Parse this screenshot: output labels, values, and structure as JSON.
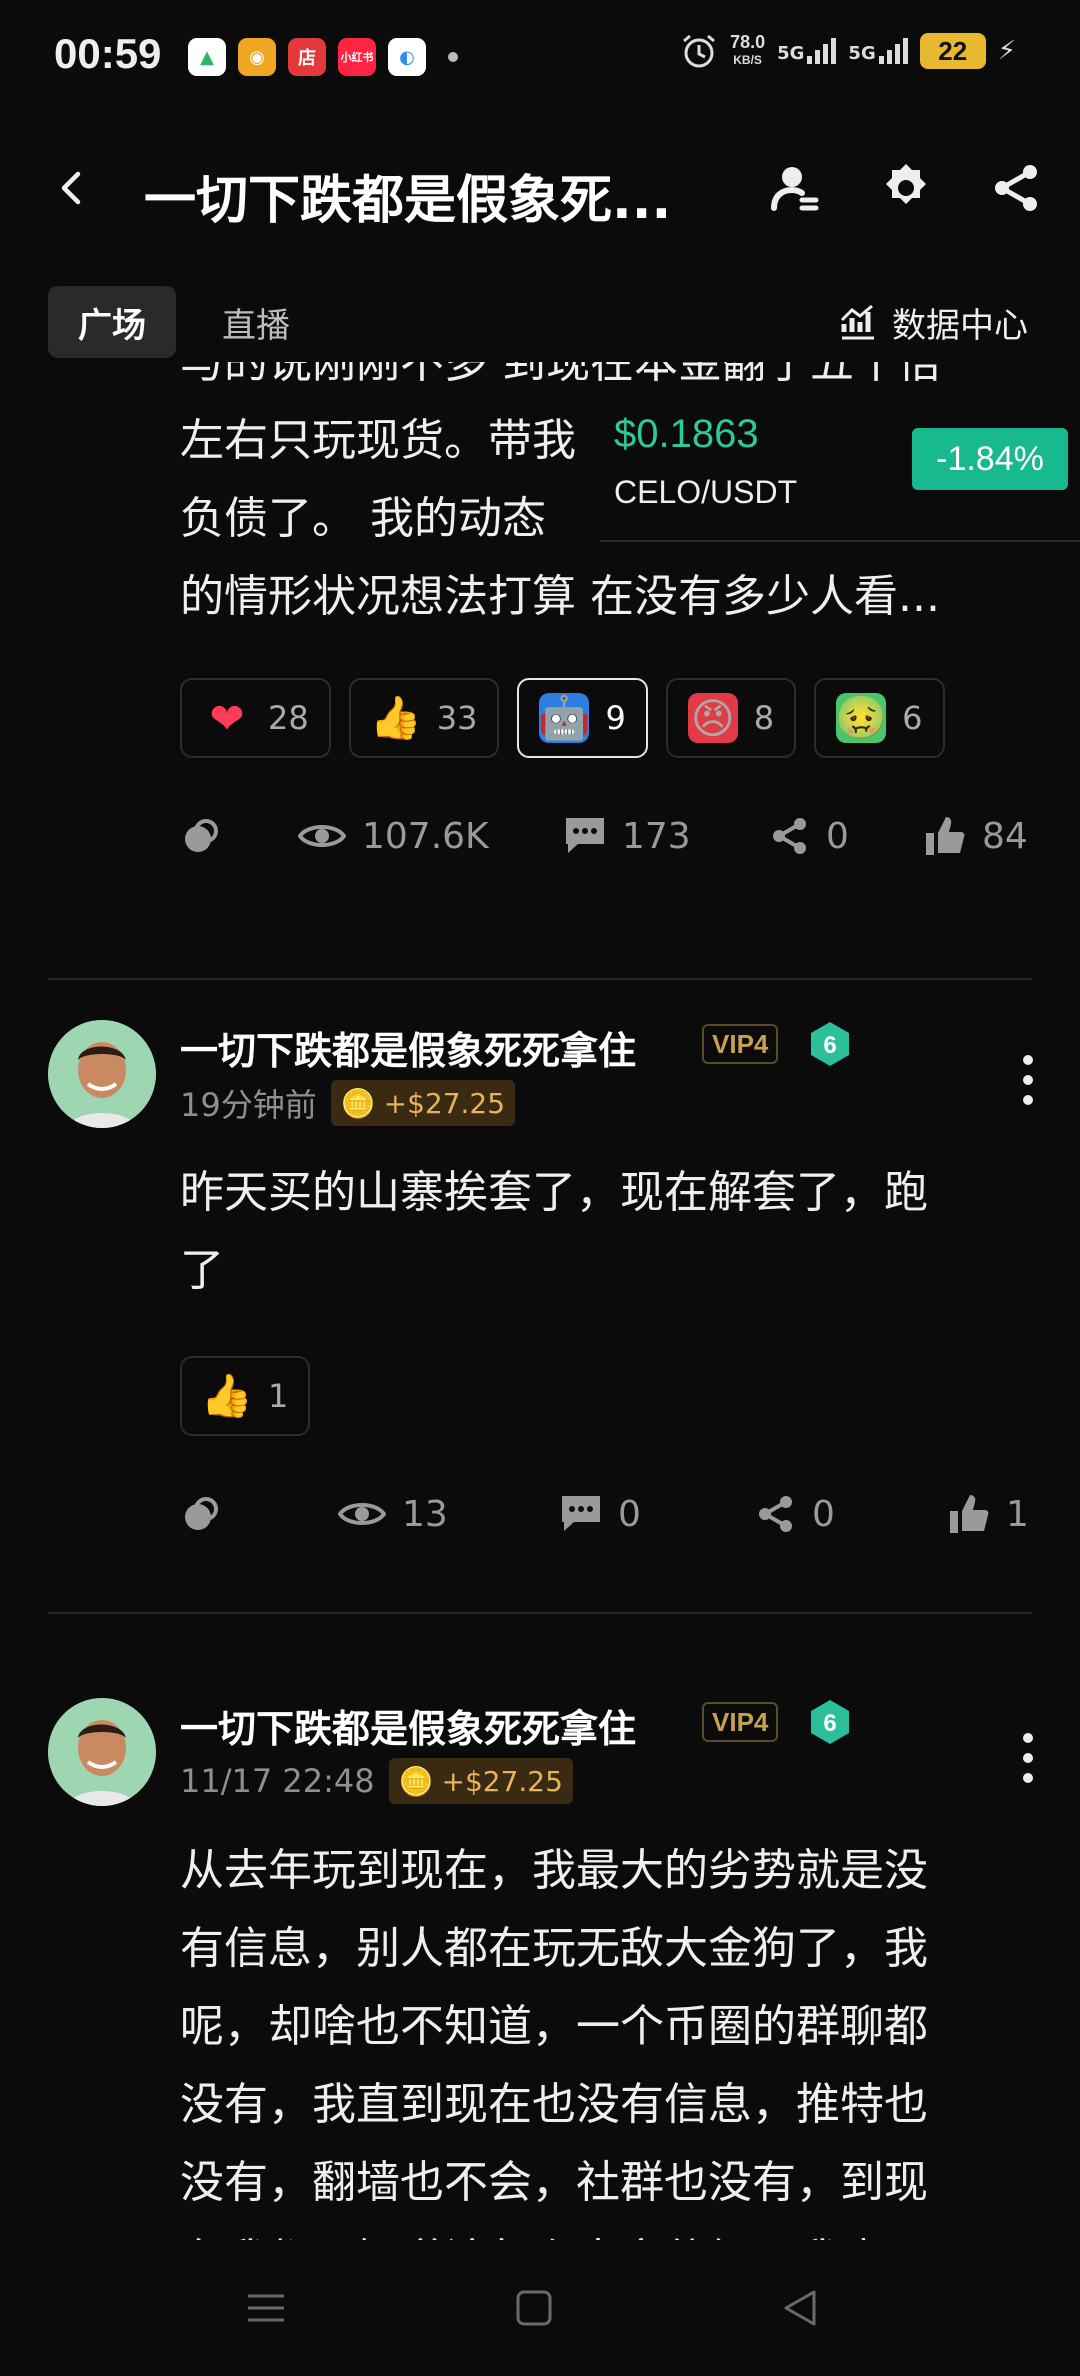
{
  "status_bar": {
    "time": "00:59",
    "apps": [
      {
        "name": "maps-app-icon",
        "glyph": "▲",
        "color": "#2fb36a"
      },
      {
        "name": "weibo-app-icon",
        "glyph": "◉",
        "color": "#f0a623"
      },
      {
        "name": "store-app-icon",
        "glyph": "店",
        "color": "#e4393c"
      },
      {
        "name": "xiaohongshu-app-icon",
        "glyph": "小红书",
        "color": "#ff2442"
      },
      {
        "name": "browser-app-icon",
        "glyph": "◐",
        "color": "#2f8ef0"
      }
    ],
    "net_speed": "78.0",
    "net_unit": "KB/S",
    "sim1": "5G",
    "sim2": "5G",
    "battery": "22"
  },
  "header": {
    "title": "一切下跌都是假象死...",
    "icons": [
      "back-icon",
      "user-profile-icon",
      "gear-icon",
      "share-icon"
    ]
  },
  "tabs": {
    "items": [
      {
        "label": "广场",
        "active": true
      },
      {
        "label": "直播",
        "active": false
      }
    ],
    "data_center": "数据中心"
  },
  "post1": {
    "text_lines": [
      "与的说刚刚不多 到现在本金翻了五十倍",
      "左右只玩现货。带我",
      "负债了。 我的动态",
      "的情形状况想法打算  在没有多少人看..."
    ],
    "ticker": {
      "price": "$0.1863",
      "pair": "CELO/USDT",
      "change": "-1.84%"
    },
    "reactions": [
      {
        "icon": "heart-icon",
        "glyph": "❤",
        "count": "28",
        "selected": false
      },
      {
        "icon": "thumbs-up-emoji-icon",
        "glyph": "👍",
        "count": "33",
        "selected": false
      },
      {
        "icon": "hodl-robot-icon",
        "glyph": "🤖",
        "count": "9",
        "selected": true
      },
      {
        "icon": "angry-face-icon",
        "glyph": "😠",
        "count": "8",
        "selected": false
      },
      {
        "icon": "sick-face-icon",
        "glyph": "🤢",
        "count": "6",
        "selected": false
      }
    ],
    "stats": {
      "views": "107.6K",
      "comments": "173",
      "shares": "0",
      "likes": "84"
    }
  },
  "post2": {
    "author": "一切下跌都是假象死死拿住",
    "vip": "VIP4",
    "level": "6",
    "time": "19分钟前",
    "tip": "+$27.25",
    "text_lines": [
      "昨天买的山寨挨套了，现在解套了，跑",
      "了"
    ],
    "reactions": [
      {
        "icon": "thumbs-up-emoji-icon",
        "glyph": "👍",
        "count": "1",
        "selected": false
      }
    ],
    "stats": {
      "views": "13",
      "comments": "0",
      "shares": "0",
      "likes": "1"
    }
  },
  "post3": {
    "author": "一切下跌都是假象死死拿住",
    "vip": "VIP4",
    "level": "6",
    "time": "11/17 22:48",
    "tip": "+$27.25",
    "text_lines": [
      "从去年玩到现在，我最大的劣势就是没",
      "有信息，别人都在玩无敌大金狗了，我",
      "呢，却啥也不知道，一个币圈的群聊都",
      "没有，我直到现在也没有信息，推特也",
      "没有，翻墙也不会，社群也没有，到现",
      "在我都不知道该怎么去文件假，我也"
    ]
  },
  "colors": {
    "accent_green": "#2ec99a",
    "tip_gold": "#e8b35a",
    "vip_gold": "#c7a24e",
    "level_teal": "#2bbf9c"
  }
}
